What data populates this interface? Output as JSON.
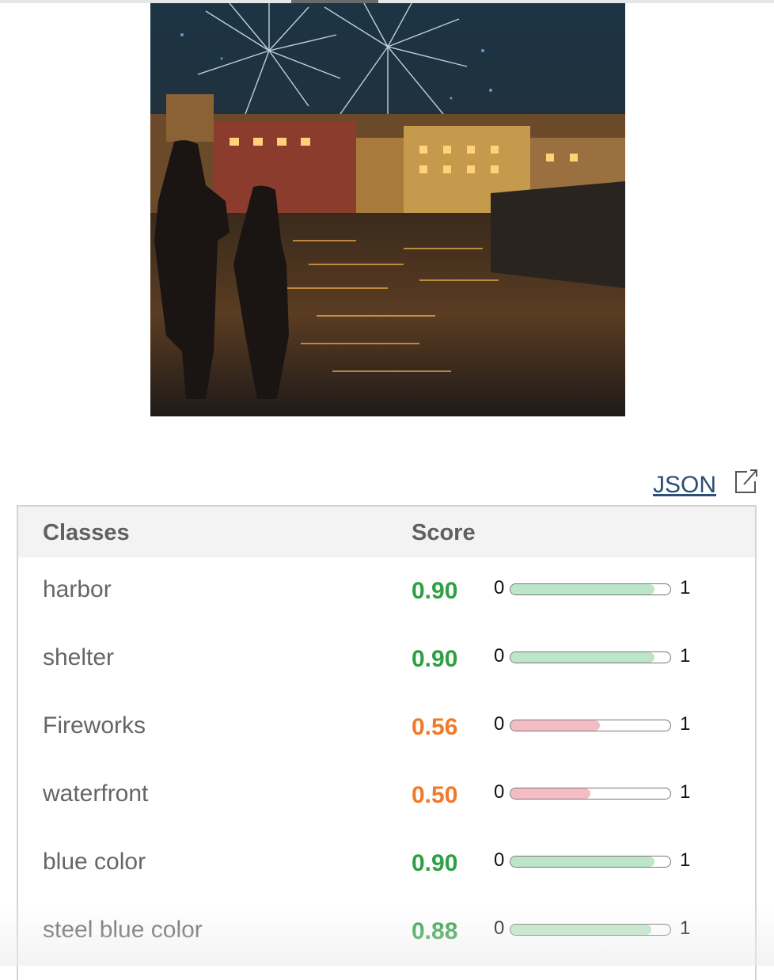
{
  "link": {
    "label": "JSON"
  },
  "icons": {
    "external": "external-link-icon"
  },
  "colors": {
    "high": "#2ea043",
    "medium": "#f07a2a",
    "fill_high": "#bde6c8",
    "fill_medium": "#f4bcc4",
    "link": "#2a4e76"
  },
  "table": {
    "headers": {
      "classes": "Classes",
      "score": "Score"
    },
    "range": {
      "min": "0",
      "max": "1"
    },
    "rows": [
      {
        "class": "harbor",
        "score": "0.90",
        "level": "high",
        "value": 0.9
      },
      {
        "class": "shelter",
        "score": "0.90",
        "level": "high",
        "value": 0.9
      },
      {
        "class": "Fireworks",
        "score": "0.56",
        "level": "medium",
        "value": 0.56
      },
      {
        "class": "waterfront",
        "score": "0.50",
        "level": "medium",
        "value": 0.5
      },
      {
        "class": "blue color",
        "score": "0.90",
        "level": "high",
        "value": 0.9
      },
      {
        "class": "steel blue color",
        "score": "0.88",
        "level": "high",
        "value": 0.88
      }
    ]
  }
}
